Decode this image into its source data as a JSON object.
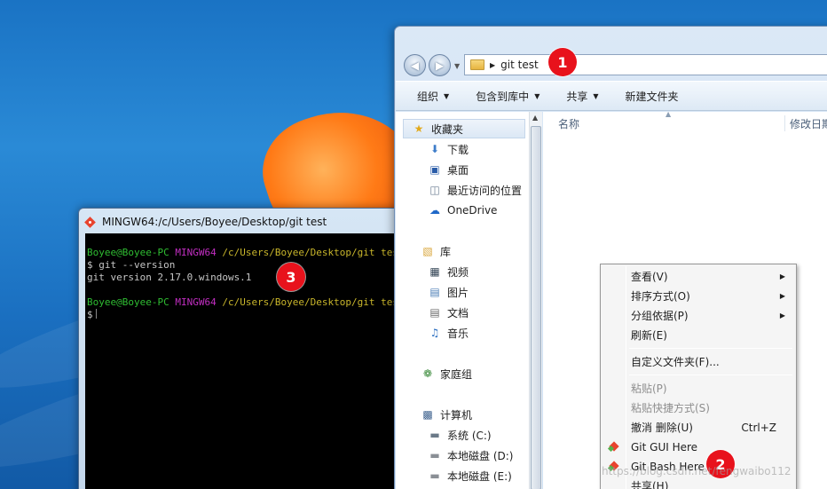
{
  "terminal": {
    "title": "MINGW64:/c/Users/Boyee/Desktop/git test",
    "lines": [
      {
        "user": "Boyee@Boyee-PC",
        "sys": "MINGW64",
        "path": "/c/Users/Boyee/Desktop/git test"
      },
      {
        "cmd": "$ git --version"
      },
      {
        "out": "git version 2.17.0.windows.1"
      },
      {
        "user": "Boyee@Boyee-PC",
        "sys": "MINGW64",
        "path": "/c/Users/Boyee/Desktop/git test"
      },
      {
        "prompt": "$"
      }
    ]
  },
  "explorer": {
    "address": "git test",
    "toolbar": [
      "组织",
      "包含到库中",
      "共享",
      "新建文件夹"
    ],
    "columns": [
      "名称",
      "修改日期"
    ],
    "nav": {
      "favorites": "收藏夹",
      "fav_items": [
        "下载",
        "桌面",
        "最近访问的位置",
        "OneDrive"
      ],
      "libraries": "库",
      "lib_items": [
        "视频",
        "图片",
        "文档",
        "音乐"
      ],
      "homegroup": "家庭组",
      "computer": "计算机",
      "drives": [
        "系统 (C:)",
        "本地磁盘 (D:)",
        "本地磁盘 (E:)"
      ]
    }
  },
  "context_menu": {
    "items": [
      {
        "label": "查看(V)",
        "submenu": true
      },
      {
        "label": "排序方式(O)",
        "submenu": true
      },
      {
        "label": "分组依据(P)",
        "submenu": true
      },
      {
        "label": "刷新(E)"
      },
      {
        "label": "自定义文件夹(F)..."
      },
      {
        "label": "粘贴(P)",
        "disabled": true
      },
      {
        "label": "粘贴快捷方式(S)",
        "disabled": true
      },
      {
        "label": "撤消 删除(U)",
        "shortcut": "Ctrl+Z"
      },
      {
        "label": "Git GUI Here",
        "icon": "git-icon"
      },
      {
        "label": "Git Bash Here",
        "icon": "git-icon"
      },
      {
        "label": "共享(H)"
      }
    ]
  },
  "badges": [
    "1",
    "2",
    "3"
  ],
  "watermark": "https://blog.csdn.net/fengwaibo112",
  "colors": {
    "badge": "#e8121c",
    "prompt_user": "#2fbd32",
    "prompt_sys": "#c22ec2",
    "prompt_path": "#c9b62b"
  }
}
